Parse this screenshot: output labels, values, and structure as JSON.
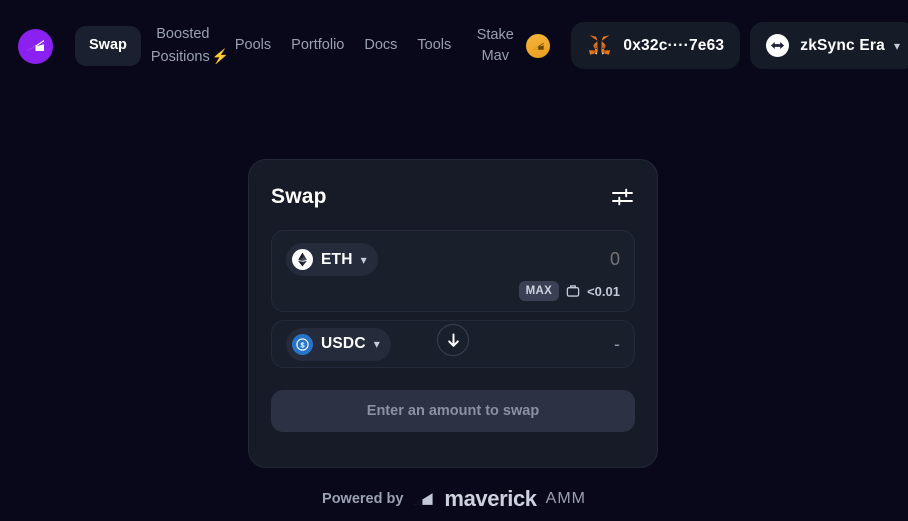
{
  "header": {
    "brand_icon": "maverick-logo-icon",
    "nav": [
      {
        "label": "Swap",
        "active": true,
        "icon": null
      },
      {
        "label": "Boosted Positions",
        "active": false,
        "icon": "lightning-bolt-icon"
      },
      {
        "label": "Pools",
        "active": false,
        "icon": null
      },
      {
        "label": "Portfolio",
        "active": false,
        "icon": null
      },
      {
        "label": "Docs",
        "active": false,
        "icon": null
      },
      {
        "label": "Tools",
        "active": false,
        "icon": null
      },
      {
        "label": "Stake Mav",
        "active": false,
        "icon": "mav-coin-icon"
      }
    ],
    "wallet": {
      "icon": "metamask-fox-icon",
      "address": "0x32c····7e63"
    },
    "network": {
      "icon": "zksync-logo-icon",
      "label": "zkSync Era",
      "chevron": "chevron-down-icon"
    }
  },
  "swap_card": {
    "title": "Swap",
    "settings_icon": "settings-sliders-icon",
    "from": {
      "token_symbol": "ETH",
      "token_icon": "eth-coin-icon",
      "chevron": "chevron-down-icon",
      "amount_value": "",
      "amount_placeholder": "0",
      "max_label": "MAX",
      "wallet_icon": "wallet-icon",
      "balance": "<0.01"
    },
    "switch_icon": "arrow-down-icon",
    "to": {
      "token_symbol": "USDC",
      "token_icon": "usdc-coin-icon",
      "chevron": "chevron-down-icon",
      "amount_value": "-"
    },
    "cta_label": "Enter an amount to swap"
  },
  "footer": {
    "powered_by": "Powered by",
    "logo_icon": "maverick-mark-icon",
    "brand": "maverick",
    "product": "AMM"
  },
  "colors": {
    "background": "#09081a",
    "card": "#161b27",
    "input": "#1a1f2c",
    "accent_purple": "#8b21f0",
    "bolt_purple": "#a855f7",
    "mav_gold": "#e89c1c",
    "usdc_blue": "#2775ca",
    "muted_text": "#99a0b0"
  }
}
